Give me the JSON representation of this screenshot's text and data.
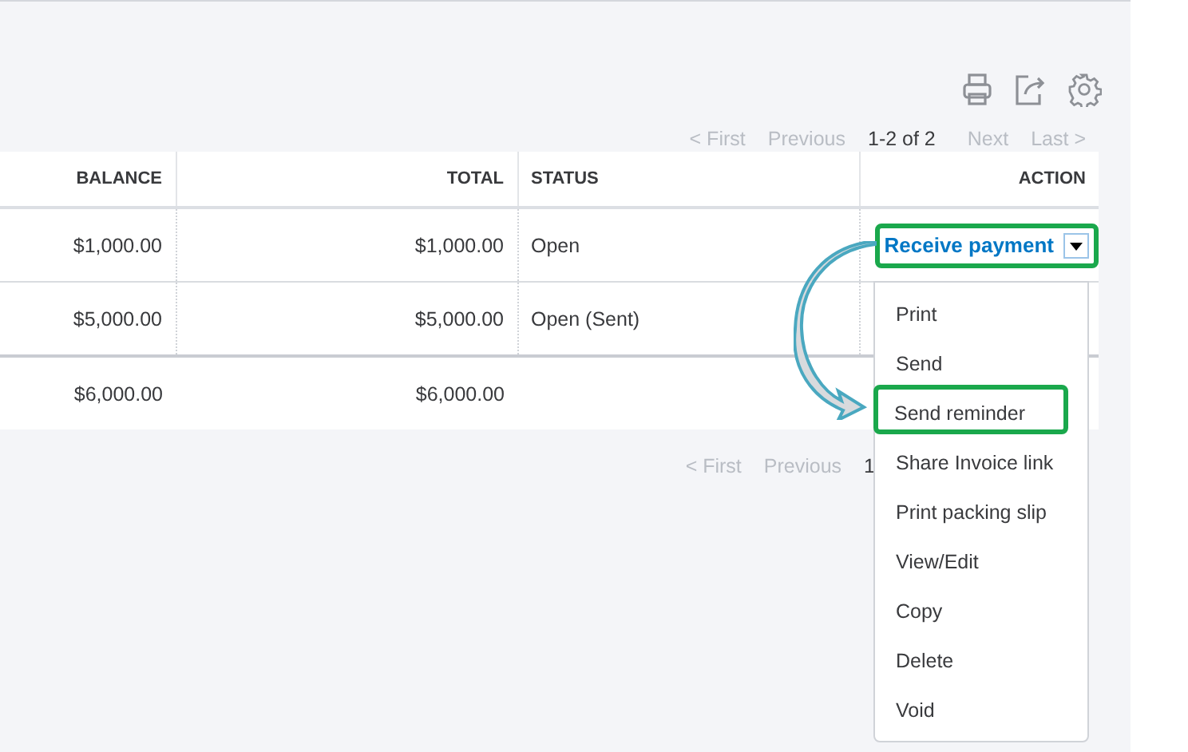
{
  "toolbar": {
    "pager": {
      "first": "< First",
      "previous": "Previous",
      "range": "1-2 of 2",
      "next": "Next",
      "last": "Last >"
    }
  },
  "table": {
    "columns": [
      "BALANCE",
      "TOTAL",
      "STATUS",
      "ACTION"
    ],
    "rows": [
      {
        "balance": "$1,000.00",
        "total": "$1,000.00",
        "status": "Open",
        "action": "Receive payment",
        "menu_open": true,
        "highlighted": true
      },
      {
        "balance": "$5,000.00",
        "total": "$5,000.00",
        "status": "Open (Sent)"
      }
    ],
    "totals": {
      "balance": "$6,000.00",
      "total": "$6,000.00"
    }
  },
  "bottom_pager": {
    "first": "< First",
    "previous": "Previous",
    "range": "1"
  },
  "action_menu": {
    "items": [
      {
        "label": "Print",
        "highlighted": false
      },
      {
        "label": "Send",
        "highlighted": false
      },
      {
        "label": "Send reminder",
        "highlighted": true
      },
      {
        "label": "Share Invoice link",
        "highlighted": false
      },
      {
        "label": "Print packing slip",
        "highlighted": false
      },
      {
        "label": "View/Edit",
        "highlighted": false
      },
      {
        "label": "Copy",
        "highlighted": false
      },
      {
        "label": "Delete",
        "highlighted": false
      },
      {
        "label": "Void",
        "highlighted": false
      }
    ]
  }
}
